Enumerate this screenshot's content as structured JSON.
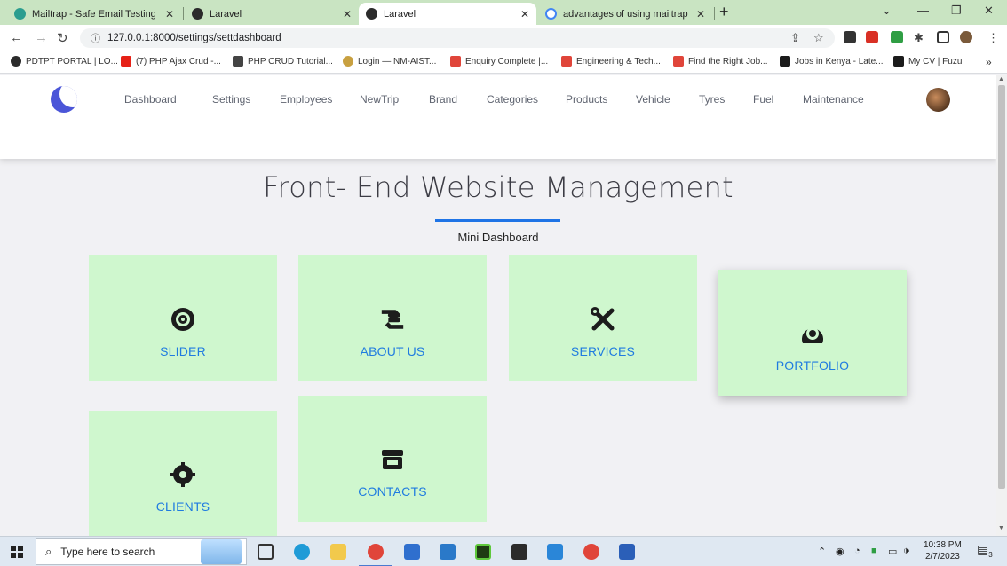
{
  "browser": {
    "tabs": [
      {
        "title": "Mailtrap - Safe Email Testing",
        "active": false
      },
      {
        "title": "Laravel",
        "active": false
      },
      {
        "title": "Laravel",
        "active": true
      },
      {
        "title": "advantages of using mailtrap in l",
        "active": false
      }
    ],
    "close_glyph": "✕",
    "new_tab_glyph": "+",
    "url": "127.0.0.1:8000/settings/settdashboard",
    "bookmarks": [
      "PDTPT PORTAL | LO...",
      "(7) PHP Ajax Crud -...",
      "PHP CRUD Tutorial...",
      "Login — NM-AIST...",
      "Enquiry Complete |...",
      "Engineering & Tech...",
      "Find the Right Job...",
      "Jobs in Kenya - Late...",
      "My CV | Fuzu"
    ],
    "bookmarks_overflow": "»"
  },
  "nav": {
    "links": [
      "Dashboard",
      "Settings",
      "Employees",
      "NewTrip",
      "Brand",
      "Categories",
      "Products",
      "Vehicle",
      "Tyres",
      "Fuel",
      "Maintenance"
    ]
  },
  "main": {
    "title": "Front- End Website Management",
    "subtitle": "Mini Dashboard",
    "cards": [
      {
        "label": "SLIDER",
        "icon": "tire-icon"
      },
      {
        "label": "ABOUT US",
        "icon": "handshake-icon"
      },
      {
        "label": "SERVICES",
        "icon": "tools-icon"
      },
      {
        "label": "PORTFOLIO",
        "icon": "tire-gauge-icon"
      },
      {
        "label": "CLIENTS",
        "icon": "gear-icon"
      },
      {
        "label": "CONTACTS",
        "icon": "store-icon"
      }
    ]
  },
  "taskbar": {
    "search_placeholder": "Type here to search",
    "time": "10:38 PM",
    "date": "2/7/2023",
    "notification_count": "3"
  },
  "colors": {
    "tabstrip": "#c9e4c2",
    "card_bg": "#cff7ce",
    "card_label": "#1f7be0",
    "accent_rule": "#1f74e6",
    "logo": "#4b56d8"
  }
}
